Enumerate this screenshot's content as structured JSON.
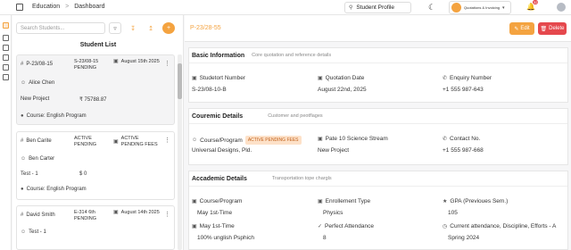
{
  "topbar": {
    "crumb_root": "Education",
    "crumb_page": "Dashboard",
    "search_value": "Student Profile",
    "app_label": "Quotations & Invoicing",
    "notif_count": "32"
  },
  "students": {
    "search_placeholder": "Search Students...",
    "list_title": "Student List",
    "cards": [
      {
        "id": "P-23/08-15",
        "quote": "S-23/08-15",
        "status": "PENDING",
        "date": "August 15th 2025",
        "name": "Alice Chen",
        "project": "New Project",
        "amount": "₹ 75788.87",
        "course": "Course: English Program"
      },
      {
        "id": "Ben Carite",
        "quote": "ACTIVE",
        "status": "PENDING",
        "date": "ACTIVE PENDING FEES",
        "name": "Ben Carter",
        "project": "Test - 1",
        "amount": "$ 0",
        "course": "Course: English Program"
      },
      {
        "id": "David Smith",
        "quote": "E-314 6th",
        "status": "PENDING",
        "date": "August 14th 2025",
        "name": "Test - 1",
        "project": "",
        "amount": "",
        "course": ""
      }
    ]
  },
  "main": {
    "header_id": "P-23/28-55",
    "edit_label": "Edit",
    "delete_label": "Delete",
    "basic": {
      "title": "Basic Information",
      "subtitle": "Core quotation and reference details",
      "student_number_label": "Studetort Number",
      "student_number": "S-23/08-10-B",
      "quotation_date_label": "Quotation Date",
      "quotation_date": "August 22nd, 2025",
      "enquiry_label": "Enquiry Number",
      "enquiry": "+1 555 987-643"
    },
    "course": {
      "title": "Couremic Details",
      "subtitle": "Customer and peotflages",
      "course_label": "Course/Program",
      "badge": "ACTIVE PENDING FEES",
      "course_value": "Universal Designs, Pld.",
      "pate_label": "Pate 10 Science Stream",
      "pate_value": "New Project",
      "contact_label": "Contact No.",
      "contact": "+1 555 987-668"
    },
    "academic": {
      "title": "Accademic Details",
      "subtitle": "Transportation tope chargls",
      "course_label": "Course/Program",
      "course_value": "May 1st-Time",
      "enroll_label": "Enrollement Type",
      "enroll_value": "Physics",
      "gpa_label": "GPA (Previoues Sem.)",
      "gpa_value": "105",
      "may_label": "May 1st-Time",
      "may_value": "100% unglish Psphich",
      "attend_label": "Perfect Attendance",
      "attend_value": "8",
      "current_label": "Current attendance, Discipline, Efforts - A",
      "current_value": "Spring 2024"
    }
  }
}
